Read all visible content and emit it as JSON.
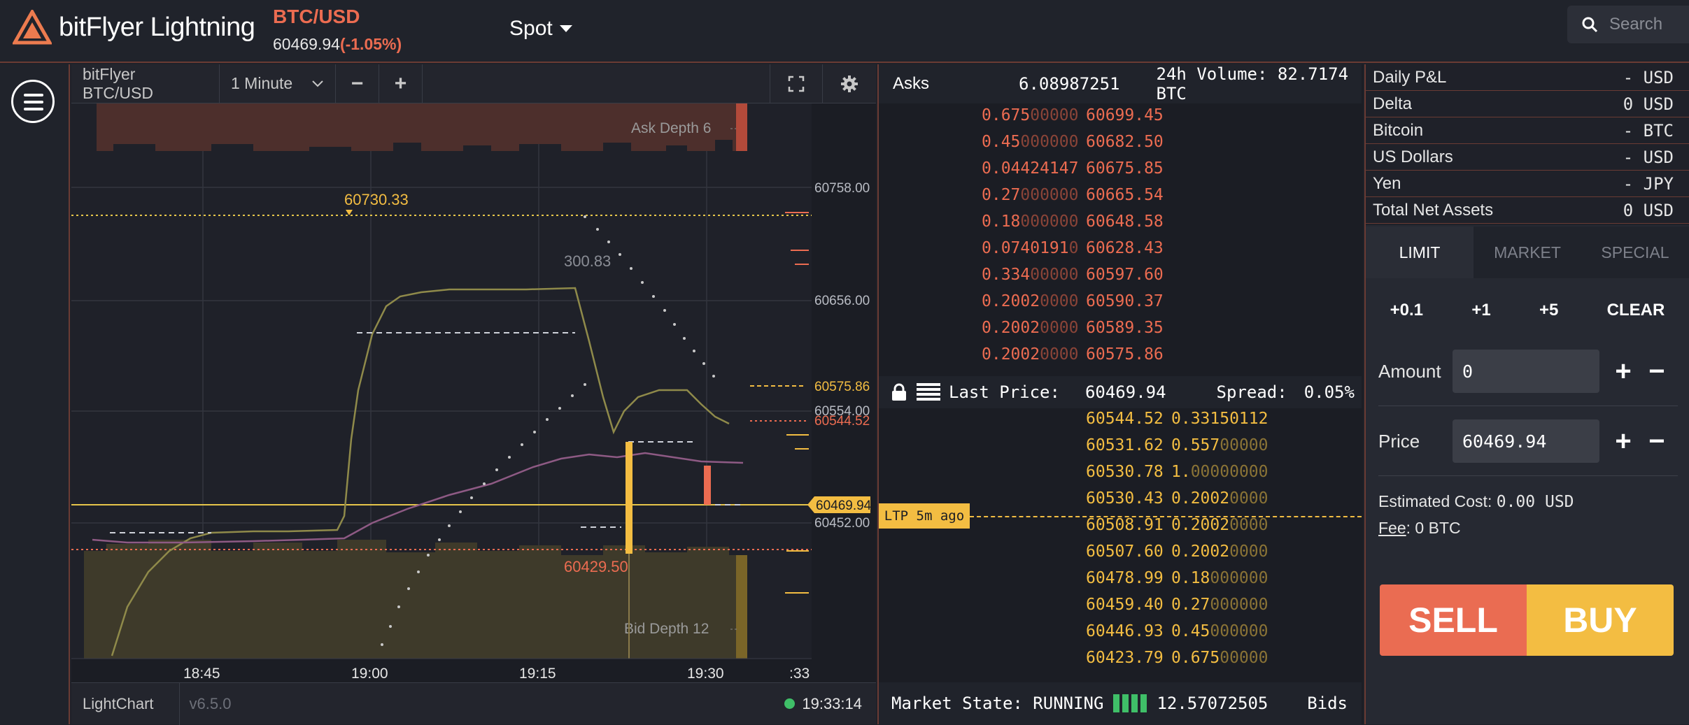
{
  "header": {
    "brand": "bitFlyer Lightning",
    "pair": "BTC/USD",
    "price": "60469.94",
    "change": "(-1.05%)",
    "market_select": "Spot",
    "search_placeholder": "Search"
  },
  "chart": {
    "product": "bitFlyer BTC/USD",
    "interval": "1 Minute",
    "footer_name": "LightChart",
    "version": "v6.5.0",
    "clock": "19:33:14",
    "ask_depth_label": "Ask Depth 6",
    "bid_depth_label": "Bid Depth 12",
    "high_label": "60730.33",
    "low_label": "60429.50",
    "range_label": "300.83",
    "y_ticks": [
      "60758.00",
      "60656.00",
      "60575.86",
      "60554.00",
      "60544.52",
      "60469.94",
      "60452.00"
    ],
    "x_ticks": [
      "18:45",
      "19:00",
      "19:15",
      "19:30",
      ":33"
    ],
    "colors": {
      "ask": "#ec6c51",
      "bid": "#f3bd42",
      "line": "#8f8a4a",
      "ma": "#8e5a84"
    }
  },
  "book": {
    "asks_label": "Asks",
    "ask_total": "6.08987251",
    "volume": "24h Volume: 82.7174 BTC",
    "asks": [
      {
        "size": "0.675",
        "size_dim": "00000",
        "price": "60699.45"
      },
      {
        "size": "0.45",
        "size_dim": "000000",
        "price": "60682.50",
        "price_dim_last": true
      },
      {
        "size": "0.04424147",
        "size_dim": "",
        "price": "60675.85"
      },
      {
        "size": "0.27",
        "size_dim": "000000",
        "price": "60665.54"
      },
      {
        "size": "0.18",
        "size_dim": "000000",
        "price": "60648.58"
      },
      {
        "size": "0.0740191",
        "size_dim": "0",
        "price": "60628.43"
      },
      {
        "size": "0.334",
        "size_dim": "00000",
        "price": "60597.60",
        "price_dim_last": true
      },
      {
        "size": "0.2002",
        "size_dim": "0000",
        "price": "60590.37"
      },
      {
        "size": "0.2002",
        "size_dim": "0000",
        "price": "60589.35"
      },
      {
        "size": "0.2002",
        "size_dim": "0000",
        "price": "60575.86"
      }
    ],
    "last_price_label": "Last Price:",
    "last_price": "60469.94",
    "spread_label": "Spread:",
    "spread": "0.05%",
    "ltp_tag": "LTP 5m ago",
    "bids": [
      {
        "price": "60544.52",
        "size": "0.33150112",
        "size_dim": ""
      },
      {
        "price": "60531.62",
        "size": "0.557",
        "size_dim": "00000"
      },
      {
        "price": "60530.78",
        "size": "1.",
        "size_dim": "00000000"
      },
      {
        "price": "60530.43",
        "size": "0.2002",
        "size_dim": "0000"
      },
      {
        "price": "60508.91",
        "size": "0.2002",
        "size_dim": "0000"
      },
      {
        "price": "60507.60",
        "size": "0.2002",
        "size_dim": "0000",
        "price_dim_last": true
      },
      {
        "price": "60478.99",
        "size": "0.18",
        "size_dim": "000000"
      },
      {
        "price": "60459.40",
        "size": "0.27",
        "size_dim": "000000",
        "price_dim_last": true
      },
      {
        "price": "60446.93",
        "size": "0.45",
        "size_dim": "000000"
      },
      {
        "price": "60423.79",
        "size": "0.675",
        "size_dim": "00000"
      }
    ],
    "market_state": "Market State: RUNNING",
    "bid_total": "12.57072505",
    "bids_label": "Bids"
  },
  "account": [
    {
      "label": "Daily P&L",
      "value": "- USD"
    },
    {
      "label": "Delta",
      "value": "0 USD"
    },
    {
      "label": "Bitcoin",
      "value": "- BTC"
    },
    {
      "label": "US Dollars",
      "value": "- USD"
    },
    {
      "label": "Yen",
      "value": "- JPY"
    },
    {
      "label": "Total Net Assets",
      "value": "0 USD"
    }
  ],
  "order": {
    "tabs": [
      "LIMIT",
      "MARKET",
      "SPECIAL"
    ],
    "quick": [
      "+0.1",
      "+1",
      "+5",
      "CLEAR"
    ],
    "amount_label": "Amount",
    "amount_value": "0",
    "price_label": "Price",
    "price_value": "60469.94",
    "est_label": "Estimated Cost:",
    "est_value": "0.00 USD",
    "fee_label": "Fee",
    "fee_value": ": 0 BTC",
    "sell": "SELL",
    "buy": "BUY"
  }
}
